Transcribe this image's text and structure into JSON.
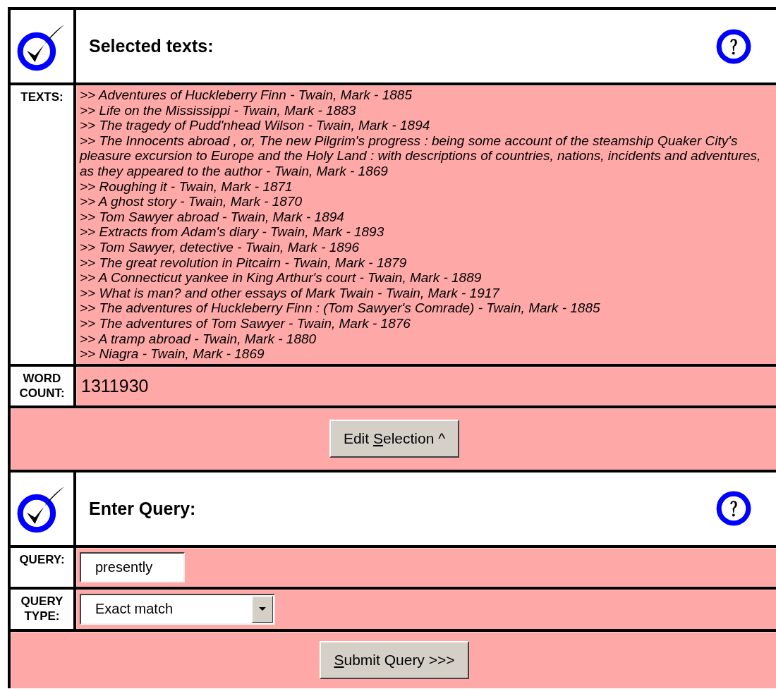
{
  "sections": [
    {
      "kind": "texts",
      "heading": "Selected texts:",
      "texts_label": "TEXTS:",
      "texts": [
        "Adventures of Huckleberry Finn - Twain, Mark - 1885",
        "Life on the Mississippi - Twain, Mark - 1883",
        "The tragedy of Pudd'nhead Wilson - Twain, Mark - 1894",
        "The Innocents abroad , or, The new Pilgrim's progress : being some account of the steamship Quaker City's pleasure excursion to Europe and the Holy Land : with descriptions of countries, nations, incidents and adventures, as they appeared to the author - Twain, Mark - 1869",
        "Roughing it - Twain, Mark - 1871",
        "A ghost story - Twain, Mark - 1870",
        "Tom Sawyer abroad - Twain, Mark - 1894",
        "Extracts from Adam's diary - Twain, Mark - 1893",
        "Tom Sawyer, detective - Twain, Mark - 1896",
        "The great revolution in Pitcairn - Twain, Mark - 1879",
        "A Connecticut yankee in King Arthur's court - Twain, Mark - 1889",
        "What is man? and other essays of Mark Twain - Twain, Mark - 1917",
        "The adventures of Huckleberry Finn : (Tom Sawyer's Comrade) - Twain, Mark - 1885",
        "The adventures of Tom Sawyer - Twain, Mark - 1876",
        "A tramp abroad - Twain, Mark - 1880",
        "Niagra - Twain, Mark - 1869"
      ],
      "bullet": ">>",
      "count_label": "WORD COUNT:",
      "count": "1311930",
      "button": {
        "before": "Edit ",
        "key": "S",
        "after": "election ^"
      }
    },
    {
      "kind": "query",
      "heading": "Enter Query:",
      "query_label": "QUERY:",
      "query": "presently",
      "type_label": "QUERY TYPE:",
      "type": "Exact match",
      "button": {
        "key": "S",
        "after": "ubmit Query >>>"
      }
    }
  ]
}
